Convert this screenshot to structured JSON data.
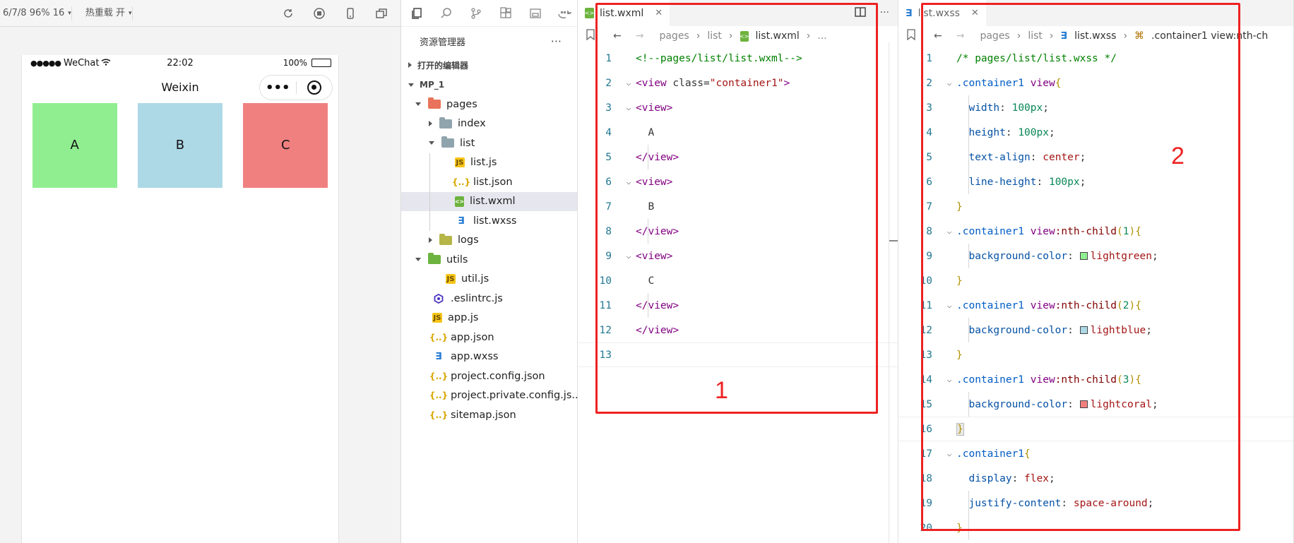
{
  "simulator": {
    "toolbar_device": "6/7/8 96% 16",
    "toolbar_hot_reload": "热重载 开",
    "status_signal": "●●●●●",
    "status_carrier": "WeChat",
    "status_time": "22:02",
    "status_battery": "100%",
    "nav_title": "Weixin",
    "boxes": [
      {
        "label": "A",
        "color": "#90ee90"
      },
      {
        "label": "B",
        "color": "#add8e6"
      },
      {
        "label": "C",
        "color": "#f08080"
      }
    ]
  },
  "explorer": {
    "title": "资源管理器",
    "more": "···",
    "open_editors": "打开的编辑器",
    "project": "MP_1",
    "tree": [
      {
        "label": "pages",
        "kind": "folder-open",
        "level": 1,
        "color": "#e8735a"
      },
      {
        "label": "index",
        "kind": "folder",
        "level": 2,
        "color": "#90a4ae"
      },
      {
        "label": "list",
        "kind": "folder-open",
        "level": 2,
        "color": "#90a4ae"
      },
      {
        "label": "list.js",
        "kind": "js",
        "level": 3
      },
      {
        "label": "list.json",
        "kind": "json",
        "level": 3
      },
      {
        "label": "list.wxml",
        "kind": "wxml",
        "level": 3,
        "selected": true
      },
      {
        "label": "list.wxss",
        "kind": "wxss",
        "level": 3
      },
      {
        "label": "logs",
        "kind": "folder",
        "level": 2,
        "color": "#b5b548"
      },
      {
        "label": "utils",
        "kind": "folder-open",
        "level": 1,
        "color": "#6db33f"
      },
      {
        "label": "util.js",
        "kind": "js",
        "level": 2
      },
      {
        "label": ".eslintrc.js",
        "kind": "eslint",
        "level": 1
      },
      {
        "label": "app.js",
        "kind": "js",
        "level": 1
      },
      {
        "label": "app.json",
        "kind": "json",
        "level": 1
      },
      {
        "label": "app.wxss",
        "kind": "wxss",
        "level": 1
      },
      {
        "label": "project.config.json",
        "kind": "json",
        "level": 1
      },
      {
        "label": "project.private.config.js...",
        "kind": "json",
        "level": 1
      },
      {
        "label": "sitemap.json",
        "kind": "json",
        "level": 1
      }
    ]
  },
  "editor1": {
    "tab": "list.wxml",
    "crumbs": [
      "pages",
      "list",
      "list.wxml",
      "..."
    ],
    "annotation": "1"
  },
  "editor2": {
    "tab": "list.wxss",
    "crumbs": [
      "pages",
      "list",
      "list.wxss",
      ".container1 view:nth-ch"
    ],
    "annotation": "2"
  }
}
